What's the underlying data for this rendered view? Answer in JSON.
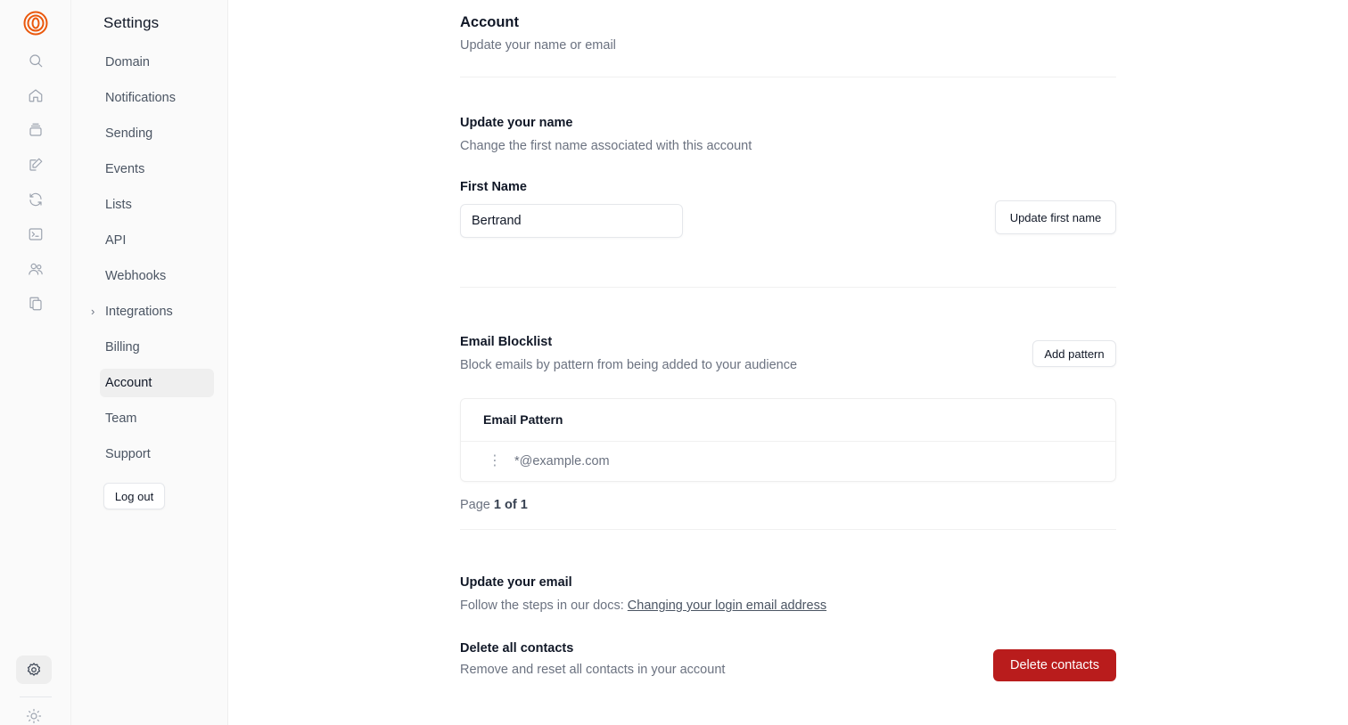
{
  "rail": {
    "icons": [
      "logo-icon",
      "search-icon",
      "home-icon",
      "inbox-icon",
      "compose-icon",
      "refresh-icon",
      "terminal-icon",
      "users-icon",
      "copy-icon",
      "settings-icon",
      "sun-icon"
    ]
  },
  "settings_nav": {
    "title": "Settings",
    "items": [
      {
        "label": "Domain"
      },
      {
        "label": "Notifications"
      },
      {
        "label": "Sending"
      },
      {
        "label": "Events"
      },
      {
        "label": "Lists"
      },
      {
        "label": "API"
      },
      {
        "label": "Webhooks"
      },
      {
        "label": "Integrations"
      },
      {
        "label": "Billing"
      },
      {
        "label": "Account"
      },
      {
        "label": "Team"
      },
      {
        "label": "Support"
      }
    ],
    "active": "Account",
    "logout_label": "Log out"
  },
  "account": {
    "title": "Account",
    "subtitle": "Update your name or email"
  },
  "update_name": {
    "title": "Update your name",
    "description": "Change the first name associated with this account",
    "field_label": "First Name",
    "field_value": "Bertrand",
    "button_label": "Update first name"
  },
  "blocklist": {
    "title": "Email Blocklist",
    "description": "Block emails by pattern from being added to your audience",
    "add_button_label": "Add pattern",
    "column_header": "Email Pattern",
    "rows": [
      {
        "pattern": "*@example.com"
      }
    ],
    "pager_prefix": "Page",
    "pager_value": "1 of 1"
  },
  "update_email": {
    "title": "Update your email",
    "description_prefix": "Follow the steps in our docs:",
    "link_text": "Changing your login email address"
  },
  "delete_contacts": {
    "title": "Delete all contacts",
    "description": "Remove and reset all contacts in your account",
    "button_label": "Delete contacts"
  },
  "colors": {
    "accent_orange": "#ea580c",
    "danger": "#b91c1c"
  }
}
